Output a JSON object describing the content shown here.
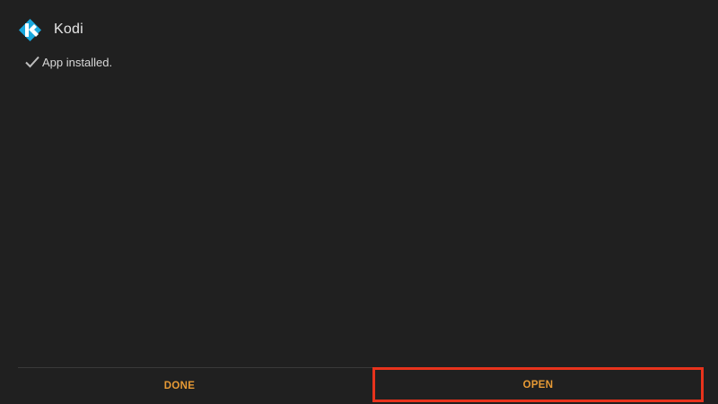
{
  "app": {
    "name": "Kodi",
    "icon": "kodi-logo-icon"
  },
  "status": {
    "icon": "checkmark-icon",
    "text": "App installed."
  },
  "actions": {
    "done_label": "DONE",
    "open_label": "OPEN"
  },
  "colors": {
    "background": "#202020",
    "accent": "#e79a35",
    "highlight_border": "#e8331c",
    "logo_blue": "#19a8dd"
  }
}
